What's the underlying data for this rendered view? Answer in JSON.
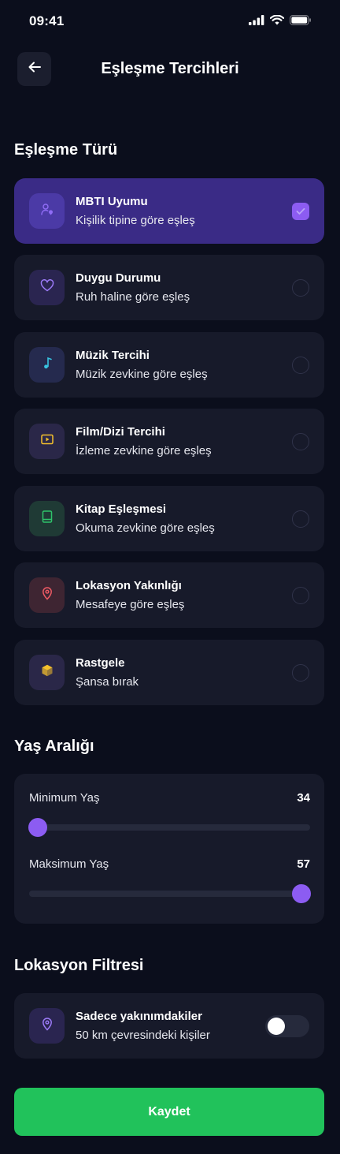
{
  "status_bar": {
    "time": "09:41"
  },
  "header": {
    "title": "Eşleşme Tercihleri"
  },
  "sections": {
    "match_type": "Eşleşme Türü",
    "age_range": "Yaş Aralığı",
    "location_filter": "Lokasyon Filtresi"
  },
  "match_options": [
    {
      "title": "MBTI Uyumu",
      "subtitle": "Kişilik tipine göre eşleş",
      "icon": "person-pin-icon",
      "icon_color": "#8f6cf5",
      "icon_bg": "#4b3aa6",
      "selected": true
    },
    {
      "title": "Duygu Durumu",
      "subtitle": "Ruh haline göre eşleş",
      "icon": "heart-icon",
      "icon_color": "#9b7af7",
      "icon_bg": "#2a2550",
      "selected": false
    },
    {
      "title": "Müzik Tercihi",
      "subtitle": "Müzik zevkine göre eşleş",
      "icon": "music-note-icon",
      "icon_color": "#38c3e0",
      "icon_bg": "#252a4e",
      "selected": false
    },
    {
      "title": "Film/Dizi Tercihi",
      "subtitle": "İzleme zevkine göre eşleş",
      "icon": "play-icon",
      "icon_color": "#f4c02c",
      "icon_bg": "#2a2748",
      "selected": false
    },
    {
      "title": "Kitap Eşleşmesi",
      "subtitle": "Okuma zevkine göre eşleş",
      "icon": "book-icon",
      "icon_color": "#2fc36a",
      "icon_bg": "#1f3a35",
      "selected": false
    },
    {
      "title": "Lokasyon Yakınlığı",
      "subtitle": "Mesafeye göre eşleş",
      "icon": "location-pin-icon",
      "icon_color": "#ee5a64",
      "icon_bg": "#3e2532",
      "selected": false
    },
    {
      "title": "Rastgele",
      "subtitle": "Şansa bırak",
      "icon": "dice-icon",
      "icon_color": "#f4c02c",
      "icon_bg": "#2a2748",
      "selected": false
    }
  ],
  "age_range": {
    "min": {
      "label": "Minimum Yaş",
      "value": "34",
      "fraction": 0.03
    },
    "max": {
      "label": "Maksimum Yaş",
      "value": "57",
      "fraction": 0.97
    }
  },
  "location_filter": {
    "title": "Sadece yakınımdakiler",
    "subtitle": "50 km çevresindeki kişiler",
    "enabled": false
  },
  "save_button": {
    "label": "Kaydet"
  },
  "colors": {
    "accent": "#8c5cf2",
    "success": "#21c25b",
    "background": "#0b0e1c",
    "card": "#171a2a",
    "card_selected": "#3a2b86"
  }
}
